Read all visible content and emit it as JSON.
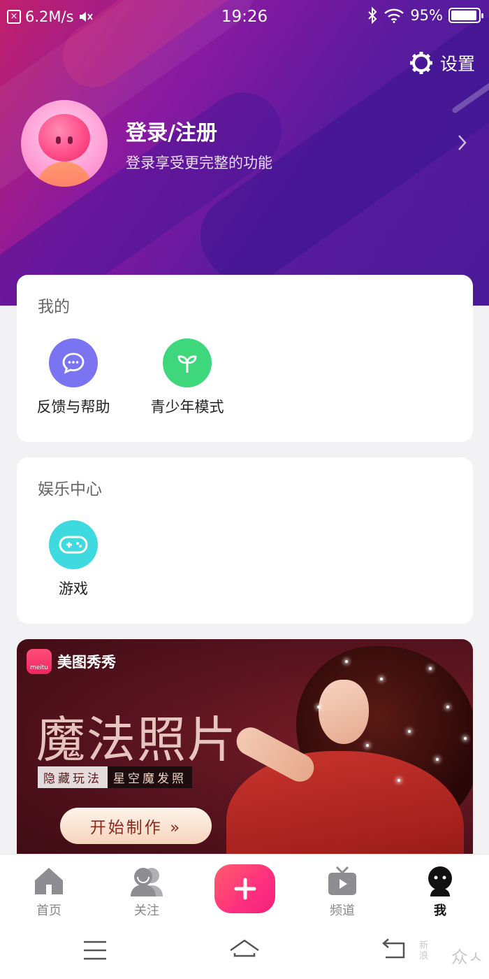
{
  "status_bar": {
    "speed": "6.2M/s",
    "time": "19:26",
    "battery": "95%",
    "battery_level": 0.95
  },
  "settings": {
    "label": "设置"
  },
  "profile": {
    "title": "登录/注册",
    "subtitle": "登录享受更完整的功能"
  },
  "mine": {
    "title": "我的",
    "items": [
      {
        "label": "反馈与帮助",
        "icon": "chat-bubble-icon",
        "color": "#7b74f0"
      },
      {
        "label": "青少年模式",
        "icon": "sprout-icon",
        "color": "#3ed77b"
      }
    ]
  },
  "entertainment": {
    "title": "娱乐中心",
    "items": [
      {
        "label": "游戏",
        "icon": "gamepad-icon",
        "color": "#3fd9e0"
      }
    ]
  },
  "banner": {
    "brand_logo_text": "meitu",
    "brand": "美图秀秀",
    "title": "魔法照片",
    "tag_left": "隐藏玩法",
    "tag_right": "星空魔发照",
    "button": "开始制作 »"
  },
  "tabs": [
    {
      "label": "首页",
      "icon": "home-icon"
    },
    {
      "label": "关注",
      "icon": "users-icon"
    },
    {
      "label": "",
      "icon": "plus-icon"
    },
    {
      "label": "频道",
      "icon": "tv-icon"
    },
    {
      "label": "我",
      "icon": "me-icon",
      "active": true
    }
  ],
  "watermark": {
    "large": "众ㅅ",
    "small": "新浪"
  },
  "colors": {
    "accent": "#ff2f7f",
    "header_start": "#c1206b",
    "header_end": "#4a1a98"
  }
}
